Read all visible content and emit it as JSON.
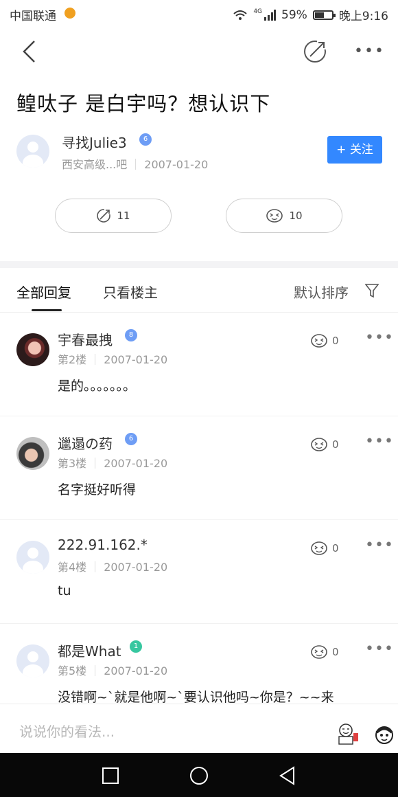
{
  "status_bar": {
    "carrier": "中国联通",
    "network": "4G",
    "battery": "59%",
    "time": "晚上9:16",
    "battery_level": 0.59
  },
  "post": {
    "title": "鳇呔子 是白宇吗？想认识下",
    "author": "寻找Julie3",
    "author_level": "6",
    "forum": "西安高级...吧",
    "date": "2007-01-20",
    "follow_label": "+ 关注",
    "share_count": "11",
    "like_count": "10"
  },
  "tabs": {
    "all": "全部回复",
    "op_only": "只看楼主",
    "sort": "默认排序"
  },
  "replies": [
    {
      "name": "宇春最拽",
      "level": "8",
      "floor": "第2楼",
      "date": "2007-01-20",
      "text": "是的。。。。。。。",
      "likes": "0"
    },
    {
      "name": "邋遢の药",
      "level": "6",
      "floor": "第3楼",
      "date": "2007-01-20",
      "text": "名字挺好听得",
      "likes": "0"
    },
    {
      "name": "222.91.162.*",
      "level": "",
      "floor": "第4楼",
      "date": "2007-01-20",
      "text": "tu",
      "likes": "0"
    },
    {
      "name": "都是What",
      "level": "1",
      "floor": "第5楼",
      "date": "2007-01-20",
      "text": "没错啊~`就是他啊~`要认识他吗~你是？~~来",
      "likes": "0"
    }
  ],
  "composer": {
    "placeholder": "说说你的看法..."
  },
  "colors": {
    "accent": "#3388ff",
    "badge_blue": "#6e9df5",
    "badge_green": "#37c7a0"
  }
}
